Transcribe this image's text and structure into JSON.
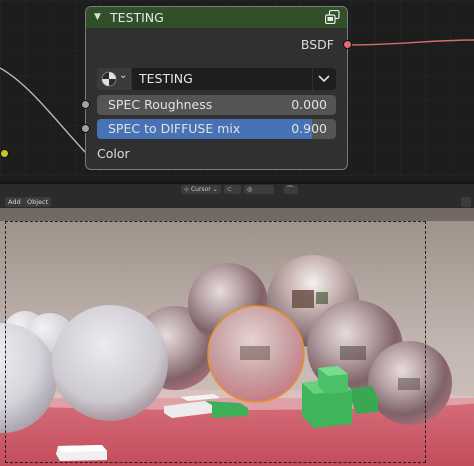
{
  "node": {
    "title": "TESTING",
    "output_socket_label": "BSDF",
    "tree_name": "TESTING",
    "inputs": [
      {
        "label": "SPEC Roughness",
        "value": "0.000",
        "fill_fraction": 0.0
      },
      {
        "label": "SPEC to DIFFUSE mix",
        "value": "0.900",
        "fill_fraction": 0.9
      }
    ],
    "color_input_label": "Color"
  },
  "viewport_toolbar": {
    "pivot_label": "Cursor"
  },
  "viewport_header": {
    "add_label": "Add",
    "object_label": "Object"
  },
  "colors": {
    "node_header": "#31502a",
    "bsdf_socket": "#e26b76",
    "float_socket": "#a1a1a1",
    "color_socket": "#c7c729",
    "slider_fill": "#4772b3",
    "selection_outline": "#e8902a"
  }
}
